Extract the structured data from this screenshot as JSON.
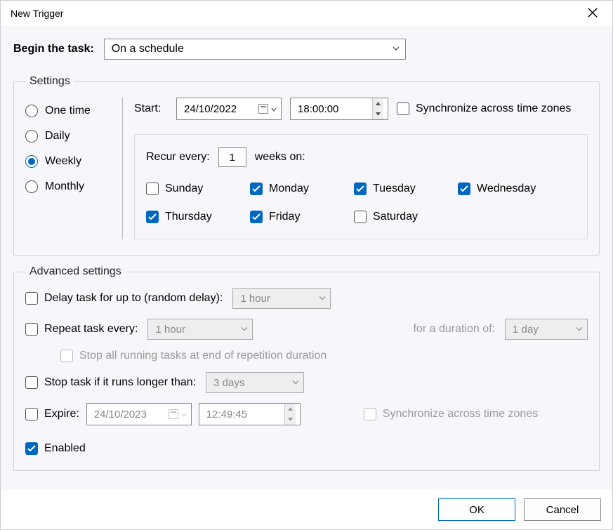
{
  "window": {
    "title": "New Trigger"
  },
  "begin": {
    "label": "Begin the task:",
    "value": "On a schedule"
  },
  "settings": {
    "legend": "Settings",
    "frequency": {
      "options": [
        "One time",
        "Daily",
        "Weekly",
        "Monthly"
      ],
      "selected": "Weekly"
    },
    "start": {
      "label": "Start:",
      "date": "24/10/2022",
      "time": "18:00:00",
      "sync_tz_label": "Synchronize across time zones",
      "sync_tz_checked": false
    },
    "recur": {
      "every_label": "Recur every:",
      "every_value": "1",
      "weeks_on_label": "weeks on:",
      "days": [
        {
          "name": "Sunday",
          "checked": false
        },
        {
          "name": "Monday",
          "checked": true
        },
        {
          "name": "Tuesday",
          "checked": true
        },
        {
          "name": "Wednesday",
          "checked": true
        },
        {
          "name": "Thursday",
          "checked": true
        },
        {
          "name": "Friday",
          "checked": true
        },
        {
          "name": "Saturday",
          "checked": false
        }
      ]
    }
  },
  "advanced": {
    "legend": "Advanced settings",
    "delay": {
      "label": "Delay task for up to (random delay):",
      "checked": false,
      "value": "1 hour"
    },
    "repeat": {
      "label": "Repeat task every:",
      "checked": false,
      "value": "1 hour",
      "duration_label": "for a duration of:",
      "duration_value": "1 day"
    },
    "stop_repeat": {
      "label": "Stop all running tasks at end of repetition duration",
      "checked": false
    },
    "stop_if": {
      "label": "Stop task if it runs longer than:",
      "checked": false,
      "value": "3 days"
    },
    "expire": {
      "label": "Expire:",
      "checked": false,
      "date": "24/10/2023",
      "time": "12:49:45",
      "sync_tz_label": "Synchronize across time zones",
      "sync_tz_checked": false
    },
    "enabled": {
      "label": "Enabled",
      "checked": true
    }
  },
  "footer": {
    "ok": "OK",
    "cancel": "Cancel"
  }
}
